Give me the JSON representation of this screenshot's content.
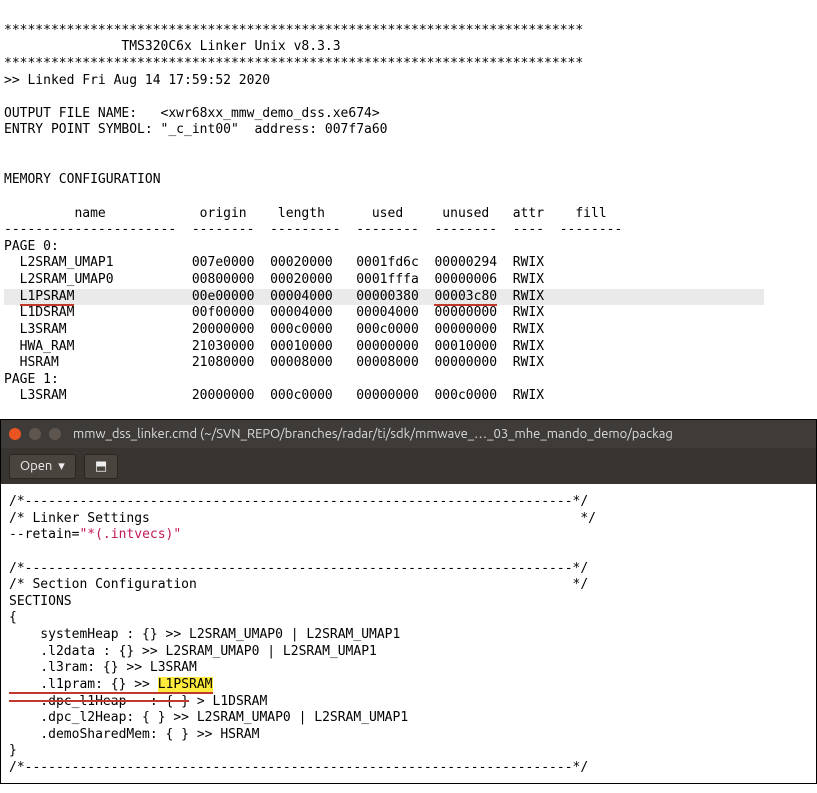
{
  "linker": {
    "star_line": "**************************************************************************",
    "title_line": "               TMS320C6x Linker Unix v8.3.3",
    "linked_line": ">> Linked Fri Aug 14 17:59:52 2020",
    "output_line": "OUTPUT FILE NAME:   <xwr68xx_mmw_demo_dss.xe674>",
    "entry_line": "ENTRY POINT SYMBOL: \"_c_int00\"  address: 007f7a60",
    "memcfg_hdr": "MEMORY CONFIGURATION",
    "col_hdr": "         name            origin    length      used     unused   attr    fill",
    "dash_line": "----------------------  --------  ---------  --------  --------  ----  --------",
    "page0": "PAGE 0:",
    "page1": "PAGE 1:",
    "rows0": [
      {
        "name": "L2SRAM_UMAP1",
        "origin": "007e0000",
        "length": "00020000",
        "used": "0001fd6c",
        "unused": "00000294",
        "attr": "RWIX"
      },
      {
        "name": "L2SRAM_UMAP0",
        "origin": "00800000",
        "length": "00020000",
        "used": "0001fffa",
        "unused": "00000006",
        "attr": "RWIX"
      },
      {
        "name": "L1PSRAM",
        "origin": "00e00000",
        "length": "00004000",
        "used": "00000380",
        "unused": "00003c80",
        "attr": "RWIX",
        "hl": true
      },
      {
        "name": "L1DSRAM",
        "origin": "00f00000",
        "length": "00004000",
        "used": "00004000",
        "unused": "00000000",
        "attr": "RWIX"
      },
      {
        "name": "L3SRAM",
        "origin": "20000000",
        "length": "000c0000",
        "used": "000c0000",
        "unused": "00000000",
        "attr": "RWIX"
      },
      {
        "name": "HWA_RAM",
        "origin": "21030000",
        "length": "00010000",
        "used": "00000000",
        "unused": "00010000",
        "attr": "RWIX"
      },
      {
        "name": "HSRAM",
        "origin": "21080000",
        "length": "00008000",
        "used": "00008000",
        "unused": "00000000",
        "attr": "RWIX"
      }
    ],
    "rows1": [
      {
        "name": "L3SRAM",
        "origin": "20000000",
        "length": "000c0000",
        "used": "00000000",
        "unused": "000c0000",
        "attr": "RWIX"
      }
    ]
  },
  "editor": {
    "title": "mmw_dss_linker.cmd (~/SVN_REPO/branches/radar/ti/sdk/mmwave_…_03_mhe_mando_demo/packag",
    "open_label": "Open",
    "open_caret": "▾",
    "new_tab_label": "⬒",
    "sep_line": "/*----------------------------------------------------------------------*/",
    "ls_open": "/* Linker Settings                                                       */",
    "retain_prefix": "--retain=",
    "retain_val": "\"*(.intvecs)\"",
    "sec_open": "/* Section Configuration                                                */",
    "sections_kw": "SECTIONS",
    "brace_open": "{",
    "brace_close": "}",
    "sec_lines": {
      "l1": "    systemHeap : {} >> L2SRAM_UMAP0 | L2SRAM_UMAP1",
      "l2": "    .l2data : {} >> L2SRAM_UMAP0 | L2SRAM_UMAP1",
      "l3": "    .l3ram: {} >> L3SRAM",
      "l4_pre": "    .l1pram: {} >> ",
      "l4_target": "L1PSRAM",
      "l5_pre_strike": "    .dpc_l1Heap   : { }",
      "l5_rest": " > L1DSRAM",
      "l6": "    .dpc_l2Heap: { } >> L2SRAM_UMAP0 | L2SRAM_UMAP1",
      "l7": "    .demoSharedMem: { } >> HSRAM"
    }
  }
}
